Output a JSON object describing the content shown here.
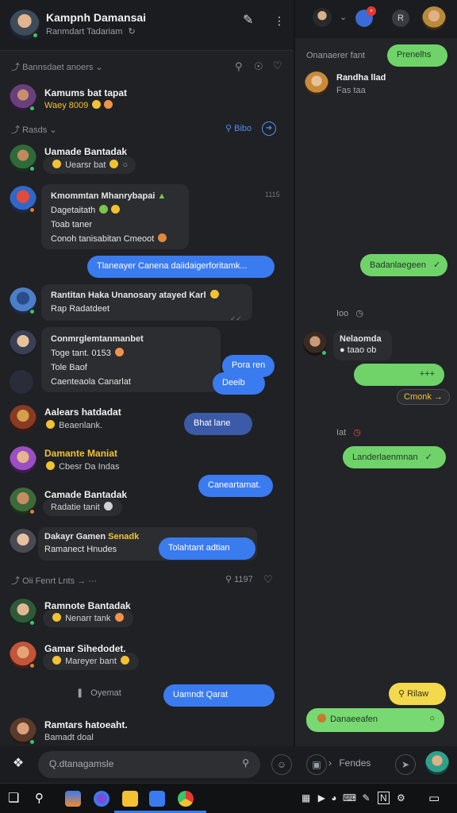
{
  "header": {
    "title": "Kampnh Damansai",
    "subtitle": "Ranmdart Tadariam",
    "subtitle_icon": "refresh-icon",
    "edit_icon": "pencil-icon",
    "menu_icon": "kebab-menu-icon"
  },
  "sections": {
    "pinned": {
      "label": "Bannsdaet anoers",
      "icons": [
        "search-icon",
        "compass-icon",
        "heart-icon"
      ]
    },
    "recent": {
      "label": "Rasds",
      "action_label": "Bibo"
    },
    "older": {
      "label": "Oii Fenrt Lnts",
      "right_label": "1197"
    }
  },
  "chats": [
    {
      "name": "Kamums bat tapat",
      "preview": "Waey 8009",
      "status": "online"
    },
    {
      "name": "Uamade Bantadak",
      "preview": "Uearsr bat",
      "status": "online"
    },
    {
      "name": "Kmommtan Mhanrybapai",
      "lines": [
        "Dagetaitath",
        "Toab taner",
        "Conoh tanisabitan Cmeoot"
      ],
      "time": "1115",
      "status": "away"
    },
    {
      "name": "Rantitan Haka Unanosary atayed Karl",
      "preview": "Rap Radatdeet",
      "status": "online"
    },
    {
      "name": "Conmrglemtanmanbet",
      "lines": [
        "Toge tant. 0153",
        "Tole Baof",
        "Caenteaola Canarlat"
      ],
      "status": "none"
    },
    {
      "name": "Aalears hatdadat",
      "preview": "Beaenlank.",
      "status": "none"
    },
    {
      "name": "Damante Maniat",
      "preview": "Cbesr Da Indas",
      "status": "none"
    },
    {
      "name": "Camade Bantadak",
      "preview": "Radatie tanit",
      "status": "away"
    },
    {
      "name": "Dakayr Gamen",
      "name_accent": "Senadk",
      "preview": "Ramanect Hnudes",
      "status": "none"
    },
    {
      "name": "Ramnote Bantadak",
      "preview": "Nenarr tank",
      "status": "online"
    },
    {
      "name": "Gamar Sihedodet.",
      "preview": "Mareyer bant",
      "status": "away"
    },
    {
      "name": "Ramtars hatoeaht.",
      "preview": "Bamadt doal",
      "status": "online"
    }
  ],
  "outgoing": [
    {
      "text": "Tlaneayer Canena daiidaigerforitamk..."
    },
    {
      "text": "Pora ren"
    },
    {
      "text": "Deeib"
    },
    {
      "text": "Bhat lane"
    },
    {
      "text": "Caneartamat."
    },
    {
      "text": "Tolahtant adtian"
    },
    {
      "text": "Uamndt Qarat"
    }
  ],
  "system_note": "Oyemat",
  "composer": {
    "placeholder": "Q.dtanagamsle",
    "search_icon": "search-icon"
  },
  "right_panel": {
    "top_label": "Onanaerer fant",
    "top_button": "Prenelhs",
    "contact": {
      "name": "Randha llad",
      "sub": "Fas taa"
    },
    "bubble_green_1": "Badanlaegeen",
    "section_1": "Ioo",
    "contact2": {
      "name": "Nelaomda",
      "sub": "taao ob"
    },
    "bubble_green_2": "+++",
    "reply_pill": "Cmonk",
    "section_2": "Iat",
    "bubble_green_3": "Landerlaenmnan",
    "bubble_yellow": "Rilaw",
    "bubble_green_4": "Danaeeafen",
    "composer_label": "Fendes"
  },
  "taskbar": {
    "apps": [
      "start-icon",
      "search-icon",
      "home-icon",
      "browser-icon",
      "folder-icon",
      "chat-icon",
      "chrome-icon"
    ],
    "tray_text": "N"
  },
  "colors": {
    "accent_blue": "#3a7bf0",
    "accent_green": "#6fd36a",
    "accent_yellow": "#f2d94e",
    "background": "#202124"
  }
}
